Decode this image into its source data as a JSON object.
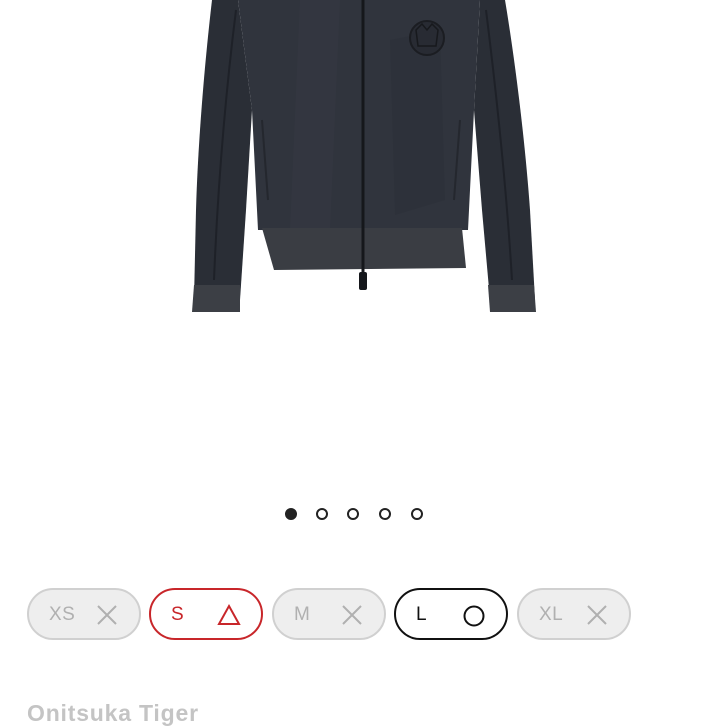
{
  "carousel": {
    "slide_count": 5,
    "active_index": 0
  },
  "sizes": [
    {
      "label": "XS",
      "status": "sold-out",
      "status_icon": "x-icon"
    },
    {
      "label": "S",
      "status": "limited",
      "status_icon": "triangle-icon"
    },
    {
      "label": "M",
      "status": "sold-out",
      "status_icon": "x-icon"
    },
    {
      "label": "L",
      "status": "available",
      "status_icon": "circle-icon"
    },
    {
      "label": "XL",
      "status": "sold-out",
      "status_icon": "x-icon"
    }
  ],
  "colors": {
    "limited": "#c8262a",
    "available": "#111111",
    "sold_out": "#b0b0b0",
    "jacket": "#2b2f38"
  },
  "product": {
    "brand": "Onitsuka Tiger"
  }
}
